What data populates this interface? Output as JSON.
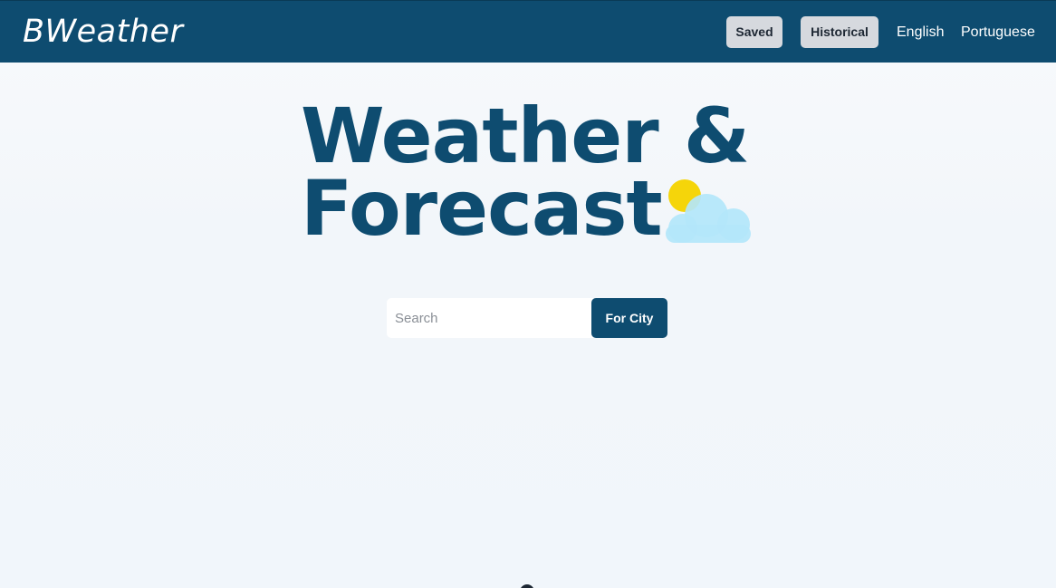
{
  "navbar": {
    "brand": "BWeather",
    "saved_label": "Saved",
    "historical_label": "Historical",
    "english_label": "English",
    "portuguese_label": "Portuguese"
  },
  "hero": {
    "title_line1": "Weather &",
    "title_line2": "Forecast",
    "icon": "sun-behind-cloud-icon"
  },
  "search": {
    "placeholder": "Search",
    "value": "",
    "button_label": "For City"
  },
  "colors": {
    "navbar_bg": "#0e4c70",
    "title": "#0e4c70",
    "nav_button_bg": "#d6d9de",
    "sun": "#f5d50a",
    "cloud": "#b3e6fa"
  }
}
